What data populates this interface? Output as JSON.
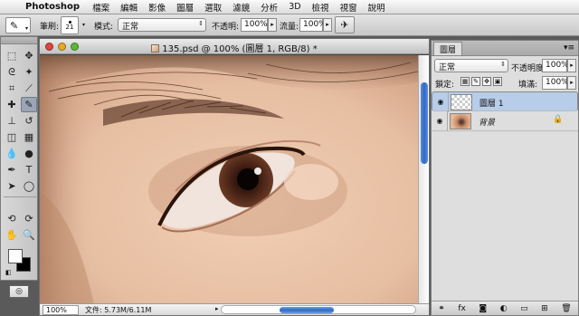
{
  "menubar": {
    "apple": "",
    "app": "Photoshop",
    "items": [
      "檔案",
      "編輯",
      "影像",
      "圖層",
      "選取",
      "濾鏡",
      "分析",
      "3D",
      "檢視",
      "視窗",
      "說明"
    ]
  },
  "options": {
    "brush_label": "筆刷:",
    "brush_size": "21",
    "mode_label": "模式:",
    "mode_value": "正常",
    "opacity_label": "不透明:",
    "opacity_value": "100%",
    "flow_label": "流量:",
    "flow_value": "100%"
  },
  "document": {
    "title": "135.psd @ 100% (圖層 1, RGB/8) *",
    "zoom": "100%",
    "info": "文件: 5.73M/6.11M"
  },
  "layers_panel": {
    "tab": "圖層",
    "blend_mode": "正常",
    "opacity_label": "不透明度:",
    "opacity_value": "100%",
    "lock_label": "鎖定:",
    "fill_label": "填滿:",
    "fill_value": "100%",
    "layers": [
      {
        "name": "圖層 1",
        "selected": true,
        "italic": false,
        "locked": false
      },
      {
        "name": "背景",
        "selected": false,
        "italic": true,
        "locked": true
      }
    ]
  },
  "colors": {
    "foreground": "#ffffff",
    "background": "#000000",
    "selection": "#b7cde9",
    "scroll_thumb": "#2f69c4"
  },
  "icons": {
    "apple": "apple-icon",
    "brush": "brush-icon",
    "airbrush": "airbrush-icon",
    "visibility": "eye-icon",
    "lock": "lock-icon"
  }
}
